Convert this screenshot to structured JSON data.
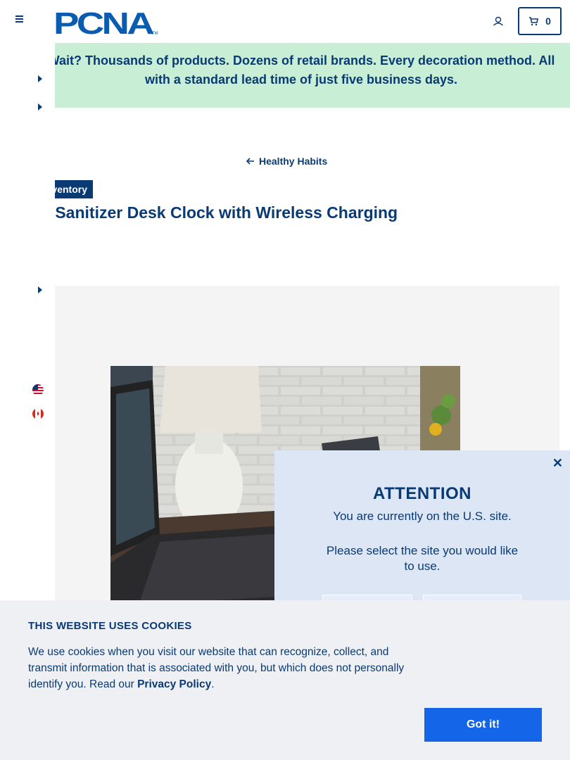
{
  "header": {
    "logo_text": "PCNA",
    "cart_count": "0"
  },
  "banner": {
    "text": "Wait? Thousands of products. Dozens of retail brands. Every decoration method. All with a standard lead time of just five business days."
  },
  "breadcrumb": {
    "back_label": "Healthy Habits"
  },
  "product": {
    "badge": "Inventory",
    "title": "UV Sanitizer Desk Clock with Wireless Charging"
  },
  "modal": {
    "title": "ATTENTION",
    "current_site": "You are currently on the U.S. site.",
    "prompt": "Please select the site you would like to use."
  },
  "cookie": {
    "title": "THIS WEBSITE USES COOKIES",
    "text_before": "We use cookies when you visit our website that can recognize, collect, and transmit information that is associated with you, but which does not personally identify you. Read our ",
    "link_label": "Privacy Policy",
    "text_after": ".",
    "button_label": "Got it!"
  },
  "colors": {
    "brand_navy": "#0a3a73",
    "banner_green": "#c8efd6",
    "modal_bg": "#dce6f5",
    "cookie_button": "#1565e8"
  }
}
